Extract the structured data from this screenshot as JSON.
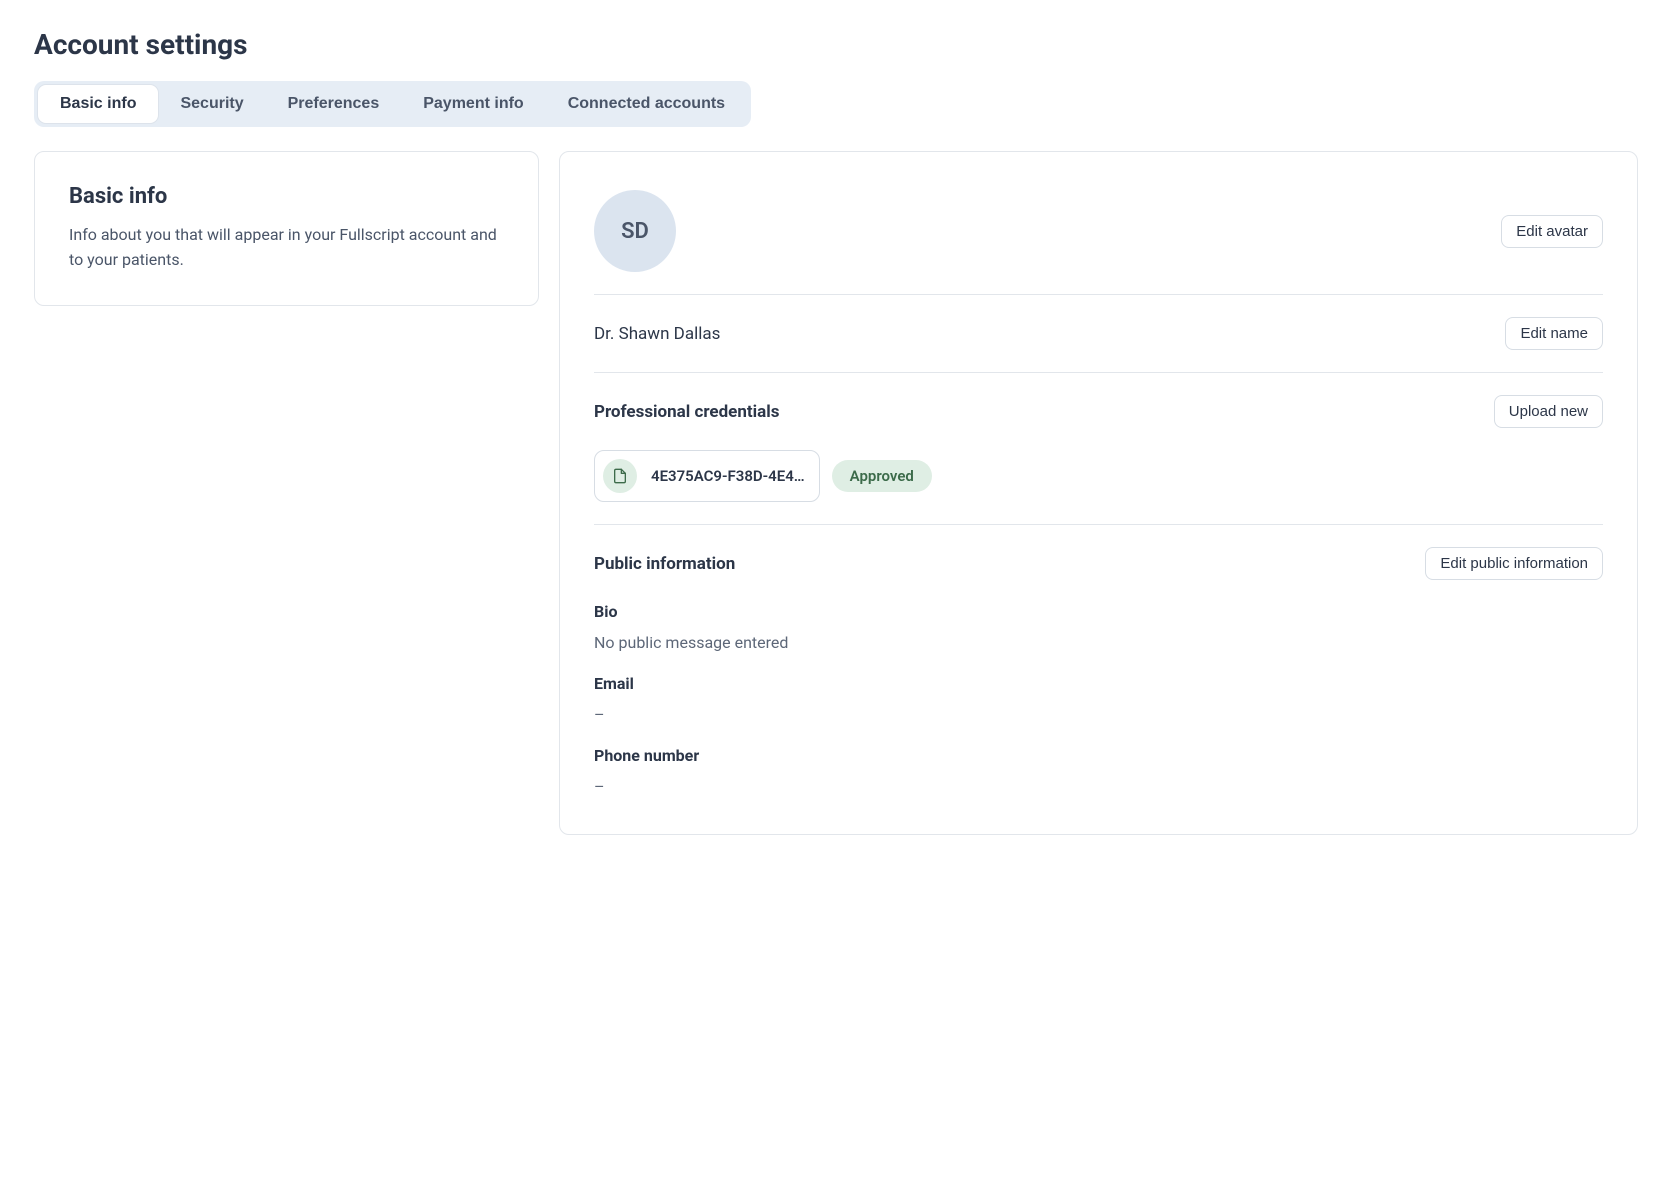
{
  "pageTitle": "Account settings",
  "tabs": [
    {
      "label": "Basic info",
      "active": true
    },
    {
      "label": "Security",
      "active": false
    },
    {
      "label": "Preferences",
      "active": false
    },
    {
      "label": "Payment info",
      "active": false
    },
    {
      "label": "Connected accounts",
      "active": false
    }
  ],
  "leftPanel": {
    "heading": "Basic info",
    "description": "Info about you that will appear in your Fullscript account and to your patients."
  },
  "avatar": {
    "initials": "SD",
    "editLabel": "Edit avatar"
  },
  "name": {
    "value": "Dr. Shawn Dallas",
    "editLabel": "Edit name"
  },
  "credentials": {
    "heading": "Professional credentials",
    "uploadLabel": "Upload new",
    "file": "4E375AC9-F38D-4E4…",
    "status": "Approved"
  },
  "publicInfo": {
    "heading": "Public information",
    "editLabel": "Edit public information",
    "fields": [
      {
        "label": "Bio",
        "value": "No public message entered"
      },
      {
        "label": "Email",
        "value": "–"
      },
      {
        "label": "Phone number",
        "value": "–"
      }
    ]
  }
}
